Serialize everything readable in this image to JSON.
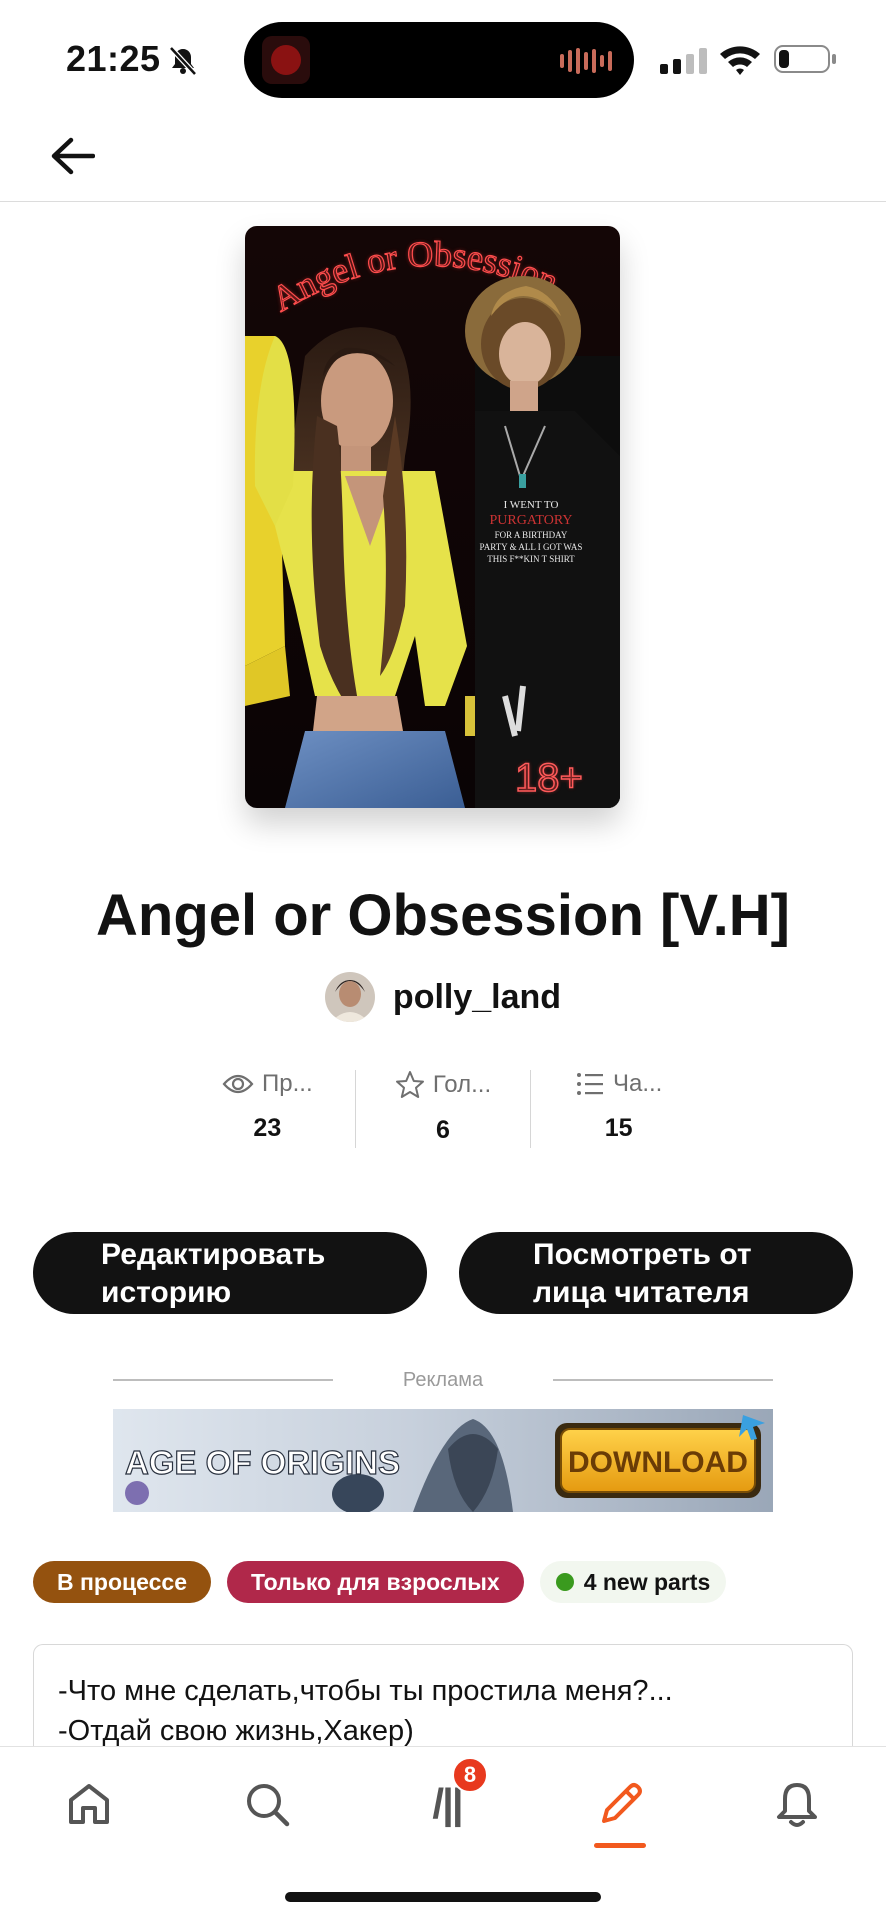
{
  "status_bar": {
    "time": "21:25"
  },
  "book": {
    "title": "Angel or Obsession [V.H]",
    "cover_title": "Angel or Obsession",
    "cover_badge": "18+",
    "shirt_text": [
      "I WENT TO",
      "PURGATORY",
      "FOR A BIRTHDAY",
      "PARTY & ALL I GOT WAS",
      "THIS F**KIN T SHIRT"
    ],
    "author": "polly_land"
  },
  "stats": [
    {
      "label": "Пр...",
      "value": "23",
      "icon": "eye-icon"
    },
    {
      "label": "Гол...",
      "value": "6",
      "icon": "star-icon"
    },
    {
      "label": "Ча...",
      "value": "15",
      "icon": "list-icon"
    }
  ],
  "buttons": {
    "edit": [
      "Редактировать",
      "историю"
    ],
    "view": [
      "Посмотреть от",
      "лица читателя"
    ]
  },
  "ad": {
    "label": "Реклама",
    "brand": "AGE OF ORIGINS",
    "cta": "DOWNLOAD"
  },
  "tags": {
    "in_progress": "В процессе",
    "mature": "Только для взрослых",
    "new_parts": "4 new parts"
  },
  "description": [
    "-Что мне сделать,чтобы ты простила меня?...",
    "-Отдай свою жизнь,Хакер)"
  ],
  "tabbar": {
    "library_badge": "8",
    "library_glyph": "/||",
    "active_tab": "write"
  },
  "colors": {
    "accent": "#f2591e",
    "tag_progress": "#94520f",
    "tag_mature": "#b0284a",
    "new_dot": "#3a9a1e",
    "button": "#121212"
  }
}
